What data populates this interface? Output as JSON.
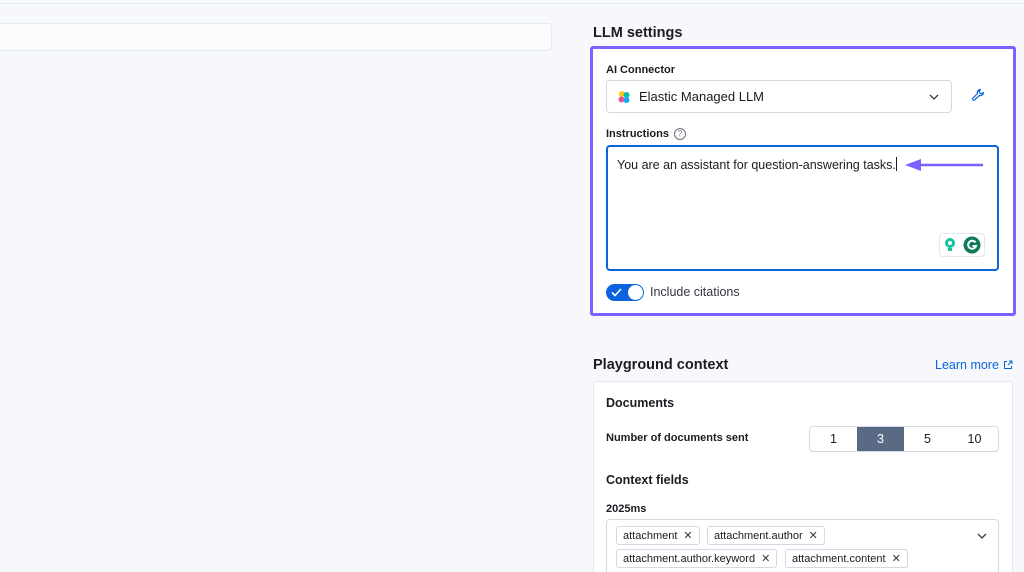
{
  "llm_settings": {
    "title": "LLM settings",
    "connector_label": "AI Connector",
    "connector_value": "Elastic Managed LLM",
    "instructions_label": "Instructions",
    "instructions_value": "You are an assistant for question-answering tasks.",
    "include_citations_label": "Include citations",
    "include_citations_on": true
  },
  "playground_context": {
    "title": "Playground context",
    "learn_more": "Learn more",
    "documents_title": "Documents",
    "docs_sent_label": "Number of documents sent",
    "docs_options": [
      "1",
      "3",
      "5",
      "10"
    ],
    "docs_selected": "3",
    "context_fields_title": "Context fields",
    "index_name": "2025ms",
    "fields": [
      "attachment",
      "attachment.author",
      "attachment.author.keyword",
      "attachment.content"
    ]
  },
  "colors": {
    "accent": "#0b64dd",
    "highlight_border": "#7b61ff",
    "selected_option": "#5a6a85"
  },
  "icons": [
    "elastic-logo-icon",
    "chevron-down-icon",
    "wrench-icon",
    "help-icon",
    "arrow-left-icon",
    "grammarly-icon",
    "external-link-icon",
    "check-icon",
    "close-icon"
  ]
}
